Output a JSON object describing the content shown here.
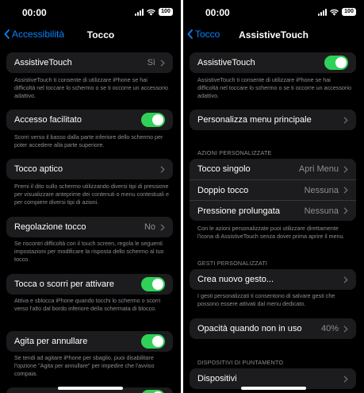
{
  "left": {
    "status": {
      "time": "00:00",
      "battery": "100"
    },
    "nav": {
      "back_label": "Accessibilità",
      "title": "Tocco"
    },
    "rows": {
      "assistivetouch": {
        "label": "AssistiveTouch",
        "value": "Sì"
      },
      "accesso": {
        "label": "Accesso facilitato"
      },
      "aptico": {
        "label": "Tocco aptico"
      },
      "regolazione": {
        "label": "Regolazione tocco",
        "value": "No"
      },
      "tocca_scorri": {
        "label": "Tocca o scorri per attivare"
      },
      "agita": {
        "label": "Agita per annullare"
      }
    },
    "notes": {
      "assistivetouch": "AssistiveTouch ti consente di utilizzare iPhone se hai difficoltà nel toccare lo schermo o se ti occorre un accessorio adattivo.",
      "accesso": "Scorri verso il basso dalla parte inferiore dello schermo per poter accedere alla parte superiore.",
      "aptico": "Premi il dito sullo schermo utilizzando diversi tipi di pressione per visualizzare anteprime dei contenuti o menu contestuali e per compiere diversi tipi di azioni.",
      "regolazione": "Se riscontri difficoltà con il touch screen, regola le seguenti impostazioni per modificare la risposta dello schermo al tuo tocco.",
      "tocca_scorri": "Attiva e sblocca iPhone quando tocchi lo schermo o scorri verso l'alto dal bordo inferiore della schermata di blocco.",
      "agita": "Se tendi ad agitare iPhone per sbaglio, puoi disabilitare l'opzione \"Agita per annullare\" per impedire che l'avviso compaia."
    }
  },
  "right": {
    "status": {
      "time": "00:00",
      "battery": "100"
    },
    "nav": {
      "back_label": "Tocco",
      "title": "AssistiveTouch"
    },
    "rows": {
      "assistivetouch": {
        "label": "AssistiveTouch"
      },
      "personalizza": {
        "label": "Personalizza menu principale"
      },
      "tocco_singolo": {
        "label": "Tocco singolo",
        "value": "Apri Menu"
      },
      "doppio_tocco": {
        "label": "Doppio tocco",
        "value": "Nessuna"
      },
      "pressione": {
        "label": "Pressione prolungata",
        "value": "Nessuna"
      },
      "crea_gesto": {
        "label": "Crea nuovo gesto..."
      },
      "opacita": {
        "label": "Opacità quando non in uso",
        "value": "40%"
      },
      "dispositivi": {
        "label": "Dispositivi"
      }
    },
    "sections": {
      "azioni": "AZIONI PERSONALIZZATE",
      "gesti": "GESTI PERSONALIZZATI",
      "puntamento": "DISPOSITIVI DI PUNTAMENTO"
    },
    "notes": {
      "assistivetouch": "AssistiveTouch ti consente di utilizzare iPhone se hai difficoltà nel toccare lo schermo o se ti occorre un accessorio adattivo.",
      "azioni": "Con le azioni personalizzate puoi utilizzare direttamente l'icona di AssistiveTouch senza dover prima aprire il menu.",
      "gesti": "I gesti personalizzati ti consentono di salvare gesti che possono essere attivati dal menu dedicato."
    }
  },
  "colors": {
    "accent": "#0a84ff",
    "toggle_on": "#30d158",
    "cell_bg": "#1c1c1e",
    "secondary_text": "#8e8e93"
  }
}
